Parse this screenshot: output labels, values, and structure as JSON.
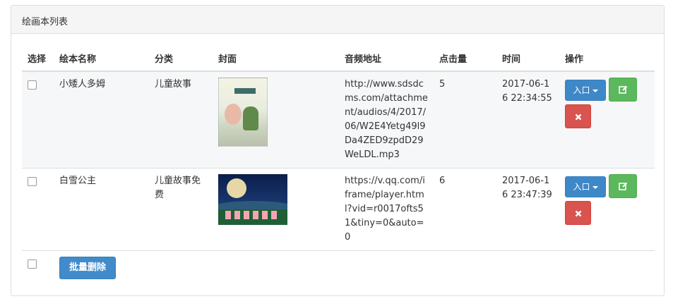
{
  "panel": {
    "title": "绘画本列表"
  },
  "table": {
    "headers": [
      "选择",
      "绘本名称",
      "分类",
      "封面",
      "音频地址",
      "点击量",
      "时间",
      "操作"
    ],
    "rows": [
      {
        "name": "小矮人多姆",
        "category": "儿童故事",
        "cover": "picture-book-cover-illustration",
        "audio": "http://www.sdsdcms.com/attachment/audios/4/2017/06/W2E4Yetg49l9Da4ZED9zpdD29WeLDL.mp3",
        "clicks": "5",
        "time": "2017-06-16 22:34:55",
        "entry_label": "入口"
      },
      {
        "name": "白雪公主",
        "category": "儿童故事免费",
        "cover": "night-moon-cover-illustration",
        "audio": "https://v.qq.com/iframe/player.html?vid=r0017ofts51&tiny=0&auto=0",
        "clicks": "6",
        "time": "2017-06-16 23:47:39",
        "entry_label": "入口"
      }
    ]
  },
  "footer": {
    "batch_delete_label": "批量删除"
  },
  "icons": {
    "edit": "edit-icon",
    "delete": "close-icon",
    "dropdown": "caret-down-icon"
  },
  "colors": {
    "entry": "#3f88c8",
    "edit": "#5cb85c",
    "delete": "#d9534f",
    "batch": "#428bca"
  }
}
